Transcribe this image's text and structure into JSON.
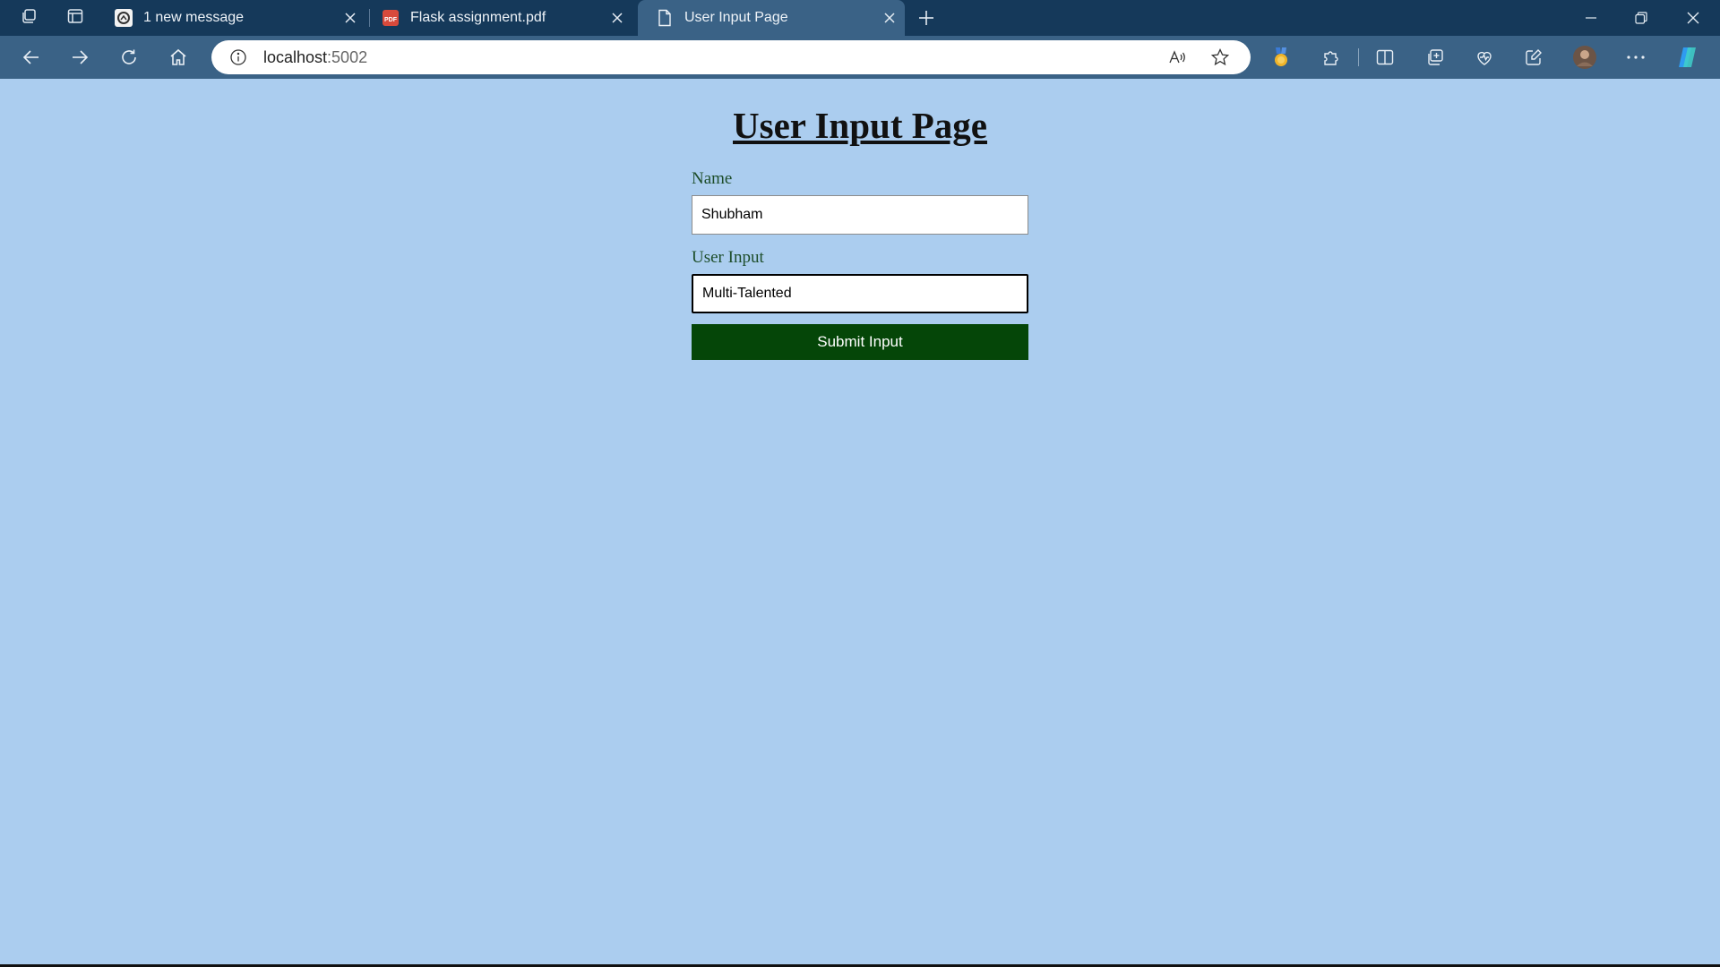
{
  "browser": {
    "tabs": [
      {
        "label": "1 new message",
        "icon": "messenger-icon",
        "active": false
      },
      {
        "label": "Flask assignment.pdf",
        "icon": "pdf-icon",
        "active": false
      },
      {
        "label": "User Input Page",
        "icon": "page-icon",
        "active": true
      }
    ],
    "address": {
      "host": "localhost",
      "port": ":5002"
    }
  },
  "page": {
    "title": "User Input Page",
    "form": {
      "name_label": "Name",
      "name_value": "Shubham",
      "input_label": "User Input",
      "input_value": "Multi-Talented",
      "submit_label": "Submit Input"
    }
  },
  "colors": {
    "page_background": "#abcdef",
    "label_color": "#1d4d2a",
    "button_background": "#054608",
    "titlebar": "#15395a",
    "toolbar": "#3a6286"
  }
}
